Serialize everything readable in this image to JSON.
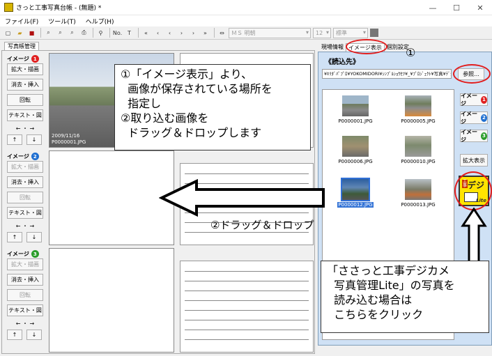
{
  "window": {
    "title": "さっと工事写真台帳 - (無題)  *",
    "controls": [
      "—",
      "☐",
      "✕"
    ]
  },
  "menu": [
    "ファイル(F)",
    "ツール(T)",
    "ヘルプ(H)"
  ],
  "toolbar": {
    "number_label": "No.",
    "font_name": "ＭＳ 明朝",
    "font_size": "12",
    "style": "標準"
  },
  "left": {
    "tab": "写真帳管理",
    "panels": [
      {
        "label": "イメージ",
        "num": "1",
        "color": "#e02020"
      },
      {
        "label": "イメージ",
        "num": "2",
        "color": "#1f6fd1"
      },
      {
        "label": "イメージ",
        "num": "3",
        "color": "#2a9d2a"
      }
    ],
    "buttons": {
      "enlarge": "拡大・描画",
      "erase": "消去・挿入",
      "rotate": "回転",
      "text": "テキスト・図",
      "lr": "← ・ →",
      "up": "↑",
      "down": "↓"
    },
    "photo1": {
      "date": "2009/11/16",
      "file": "P0000001.JPG"
    }
  },
  "right": {
    "tabs": [
      "現場情報",
      "イメージ表示",
      "個別設定"
    ],
    "dir_title": "《読込先》",
    "path": "¥ｷﾘﾀﾞﾊﾟﾌﾟﾛ¥YOKOMIDORI¥ｼﾝﾌﾟﾙｼｮｳｾﾂ¥_¥ﾌﾟﾛｼﾞｪｸﾄ¥写真¥ﾃﾞｼﾞｶﾒ写真¥工事写真¥",
    "browse": "参照...",
    "thumbs": [
      {
        "name": "P0000001.JPG",
        "selected": false
      },
      {
        "name": "P0000005.JPG",
        "selected": false
      },
      {
        "name": "P0000006.JPG",
        "selected": false
      },
      {
        "name": "P0000010.JPG",
        "selected": false
      },
      {
        "name": "P0000012.JPG",
        "selected": true
      },
      {
        "name": "P0000013.JPG",
        "selected": false
      }
    ],
    "image_buttons": [
      {
        "label": "イメージ",
        "num": "1",
        "color": "#e02020"
      },
      {
        "label": "イメージ",
        "num": "2",
        "color": "#1f6fd1"
      },
      {
        "label": "イメージ",
        "num": "3",
        "color": "#2a9d2a"
      }
    ],
    "enlarge": "拡大表示",
    "dejicam": {
      "text": "デジ",
      "e": "工事",
      "lite": "Lite"
    }
  },
  "annotations": {
    "circle1": "①",
    "instruction": "①「イメージ表示」より、\n  画像が保存されている場所を\n  指定し\n②取り込む画像を\n  ドラッグ＆ドロップします",
    "drag": "②ドラッグ＆ドロップ",
    "lite_note": "「ささっと工事デジカメ\n  写真管理Lite」の写真を\n  読み込む場合は\n  こちらをクリック"
  }
}
